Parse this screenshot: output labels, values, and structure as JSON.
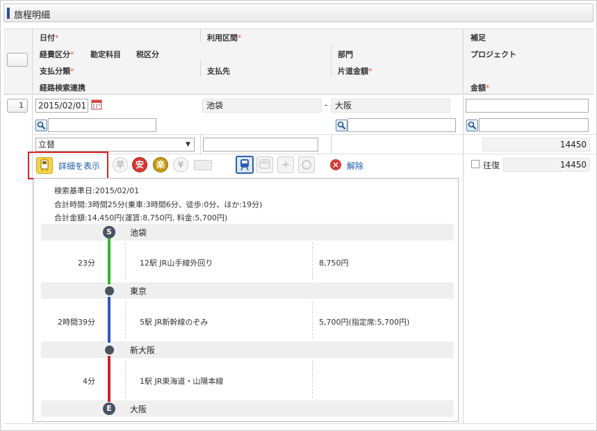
{
  "section": {
    "title": "旅程明細"
  },
  "header": {
    "row1": {
      "date": "日付",
      "route": "利用区間",
      "supplement": "補足"
    },
    "row2": {
      "expense_type": "経費区分",
      "account": "勘定科目",
      "tax": "税区分",
      "department": "部門",
      "project": "プロジェクト"
    },
    "row3": {
      "payment_class": "支払分類",
      "payee": "支払先",
      "oneway_amount": "片道金額"
    },
    "row4": {
      "route_search": "経路検索連携",
      "amount": "金額"
    },
    "required_mark": "*"
  },
  "row": {
    "number": "1",
    "date_value": "2015/02/01",
    "from_station": "池袋",
    "separator": "-",
    "to_station": "大阪",
    "payment_select": "立替",
    "oneway_amount_value": "14450",
    "roundtrip_label": "往復",
    "amount_value": "14450"
  },
  "toolbar": {
    "show_detail": "詳細を表示",
    "icon_safe": "安",
    "icon_easy": "楽",
    "icon_fast": "早",
    "icon_cheap": "¥",
    "release": "解除"
  },
  "detail": {
    "base_date": "検索基準日:2015/02/01",
    "total_time": "合計時間:3時間25分(乗車:3時間6分、徒歩:0分、ほか:19分)",
    "total_amount": "合計金額:14,450円(運賃:8,750円, 料金:5,700円)",
    "stations": [
      {
        "marker": "S",
        "name": "池袋"
      },
      {
        "marker": "",
        "name": "東京"
      },
      {
        "marker": "",
        "name": "新大阪"
      },
      {
        "marker": "E",
        "name": "大阪"
      }
    ],
    "segments": [
      {
        "duration": "23分",
        "line": "12駅  JR山手線外回り",
        "fare": "8,750円",
        "color": "#33b62c"
      },
      {
        "duration": "2時間39分",
        "line": "5駅  JR新幹線のぞみ",
        "fare": "5,700円(指定席:5,700円)",
        "color": "#2f56c4"
      },
      {
        "duration": "4分",
        "line": "1駅  JR東海道・山陽本線",
        "fare": "",
        "color": "#c8272d"
      }
    ]
  }
}
